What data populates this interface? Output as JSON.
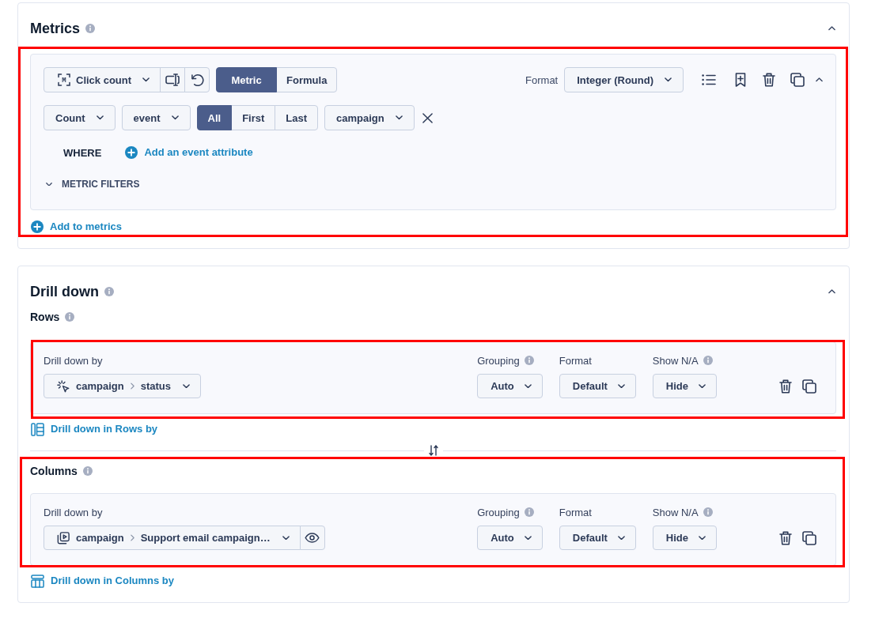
{
  "metrics": {
    "title": "Metrics",
    "expanded": true,
    "highlighted": true,
    "metric": {
      "icon_letter": "M",
      "name": "Click count",
      "modes": [
        {
          "label": "Metric",
          "selected": true
        },
        {
          "label": "Formula",
          "selected": false
        }
      ],
      "format_label": "Format",
      "format_value": "Integer (Round)",
      "expanded": true,
      "aggregation": "Count",
      "source": "event",
      "occurrences": [
        {
          "label": "All",
          "selected": true
        },
        {
          "label": "First",
          "selected": false
        },
        {
          "label": "Last",
          "selected": false
        }
      ],
      "attribute": "campaign",
      "where_label": "WHERE",
      "add_attribute_link": "Add an event attribute",
      "filters_label": "METRIC FILTERS",
      "filters_expanded": false
    },
    "add_link": "Add to metrics"
  },
  "drill_down": {
    "title": "Drill down",
    "expanded": true,
    "sections": [
      {
        "kind": "rows",
        "title": "Rows",
        "highlighted": true,
        "label": "Drill down by",
        "path": [
          "campaign",
          "status"
        ],
        "preview": false,
        "settings": [
          {
            "label": "Grouping",
            "info": true,
            "value": "Auto"
          },
          {
            "label": "Format",
            "info": false,
            "value": "Default"
          },
          {
            "label": "Show N/A",
            "info": true,
            "value": "Hide"
          }
        ],
        "add_link": "Drill down in Rows by"
      },
      {
        "kind": "columns",
        "title": "Columns",
        "highlighted": true,
        "label": "Drill down by",
        "path": [
          "campaign",
          "Support email campaign…"
        ],
        "preview": true,
        "settings": [
          {
            "label": "Grouping",
            "info": true,
            "value": "Auto"
          },
          {
            "label": "Format",
            "info": false,
            "value": "Default"
          },
          {
            "label": "Show N/A",
            "info": true,
            "value": "Hide"
          }
        ],
        "add_link": "Drill down in Columns by"
      }
    ]
  }
}
